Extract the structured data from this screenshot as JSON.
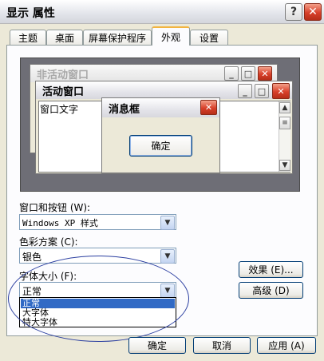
{
  "window": {
    "title": "显示 属性",
    "help_label": "?",
    "close_label": "✕"
  },
  "tabs": [
    {
      "label": "主题"
    },
    {
      "label": "桌面"
    },
    {
      "label": "屏幕保护程序"
    },
    {
      "label": "外观",
      "active": true
    },
    {
      "label": "设置"
    }
  ],
  "preview": {
    "inactive_title": "非活动窗口",
    "active_title": "活动窗口",
    "window_text": "窗口文字",
    "message_title": "消息框",
    "ok_label": "确定"
  },
  "form": {
    "windows_buttons_label": "窗口和按钮 (W):",
    "windows_buttons_value": "Windows XP 样式",
    "color_scheme_label": "色彩方案 (C):",
    "color_scheme_value": "银色",
    "font_size_label": "字体大小 (F):",
    "font_size_value": "正常",
    "font_size_options": [
      "正常",
      "大字体",
      "特大字体"
    ]
  },
  "buttons": {
    "effects": "效果 (E)...",
    "advanced": "高级 (D)",
    "ok": "确定",
    "cancel": "取消",
    "apply": "应用 (A)"
  },
  "colors": {
    "accent_tab": "#f2b440",
    "selection": "#316ac5",
    "annotation": "#2a3ea0"
  }
}
